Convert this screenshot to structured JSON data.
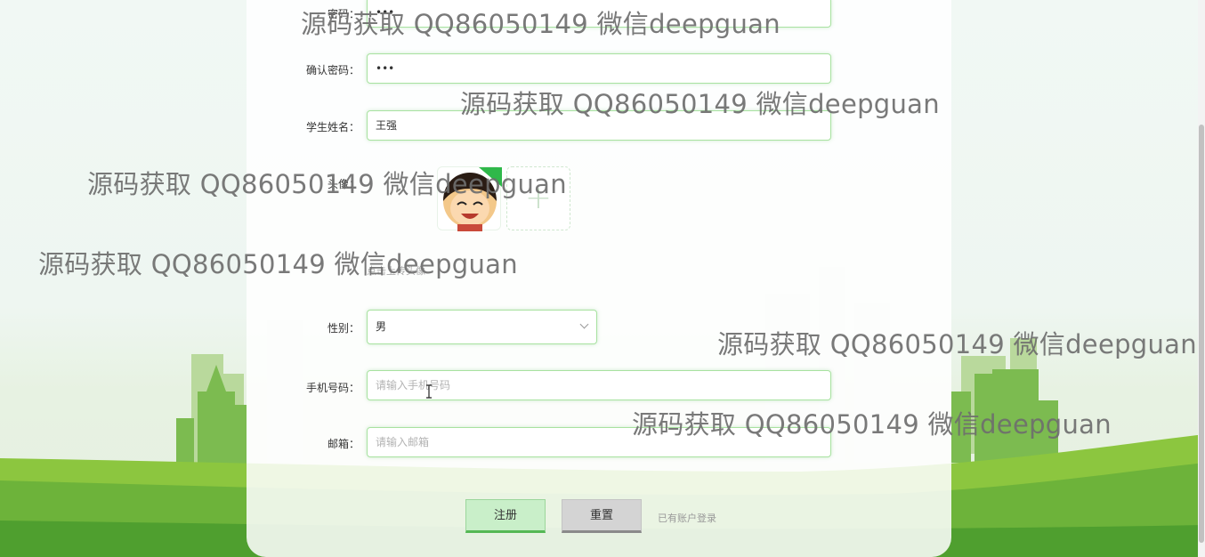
{
  "form": {
    "password_label": "密码：",
    "password_value": "•••",
    "confirm_label": "确认密码：",
    "confirm_value": "•••",
    "name_label": "学生姓名：",
    "name_value": "王强",
    "avatar_label": "头像：",
    "avatar_hint": "点击上传头像",
    "gender_label": "性别：",
    "gender_value": "男",
    "phone_label": "手机号码：",
    "phone_placeholder": "请输入手机号码",
    "email_label": "邮箱：",
    "email_placeholder": "请输入邮箱"
  },
  "actions": {
    "register_label": "注册",
    "reset_label": "重置",
    "login_link": "已有账户登录"
  },
  "watermark": {
    "text": "源码获取 QQ86050149 微信deepguan"
  },
  "colors": {
    "accent": "#55b855",
    "field_border": "#a8e2a0",
    "city_green": "#6cae45"
  }
}
